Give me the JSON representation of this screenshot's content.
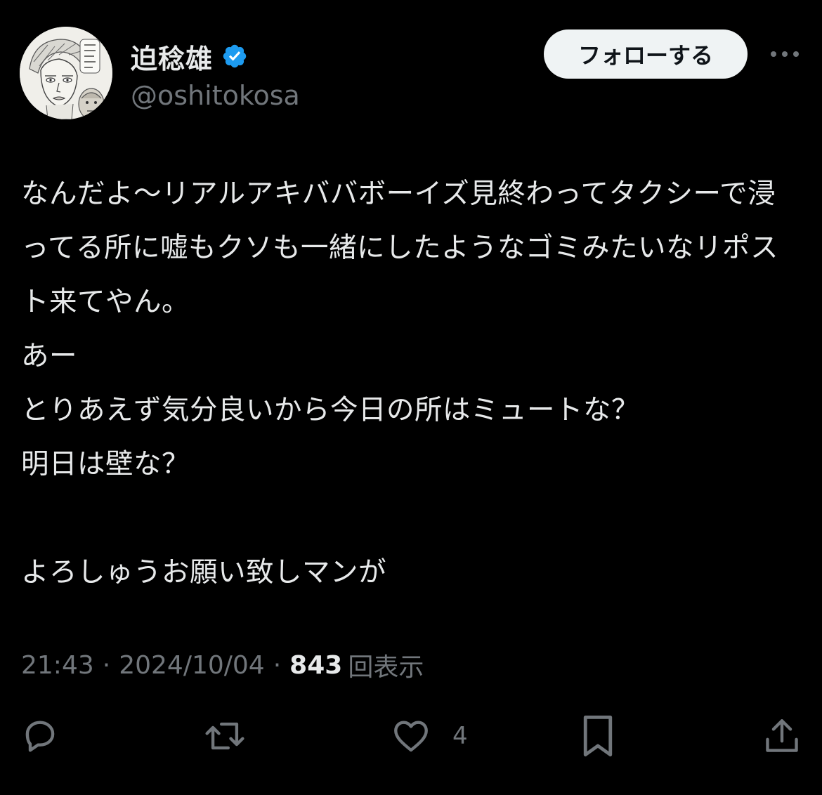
{
  "author": {
    "display_name": "迫稔雄",
    "handle": "@oshitokosa",
    "avatar_icon": "avatar-manga-drawing",
    "verified_icon": "verified-badge-icon"
  },
  "follow_button": {
    "label": "フォローする"
  },
  "more_icon": "more-horizontal-icon",
  "tweet": {
    "text": "なんだよ〜リアルアキババボーイズ見終わってタクシーで浸ってる所に嘘もクソも一緒にしたようなゴミみたいなリポスト来てやん。\nあー\nとりあえず気分良いから今日の所はミュートな？\n明日は壁な？\n\nよろしゅうお願い致しマンが"
  },
  "meta": {
    "time": "21:43",
    "separator": "·",
    "date": "2024/10/04",
    "views_count": "843",
    "views_label": "回表示"
  },
  "actions": {
    "reply_icon": "reply-icon",
    "repost_icon": "repost-icon",
    "like_icon": "heart-icon",
    "like_count": "4",
    "bookmark_icon": "bookmark-icon",
    "share_icon": "share-icon"
  },
  "colors": {
    "background": "#000000",
    "text_primary": "#e7e9ea",
    "text_secondary": "#71767b",
    "verified_blue": "#1d9bf0",
    "follow_button_bg": "#eff3f4"
  }
}
